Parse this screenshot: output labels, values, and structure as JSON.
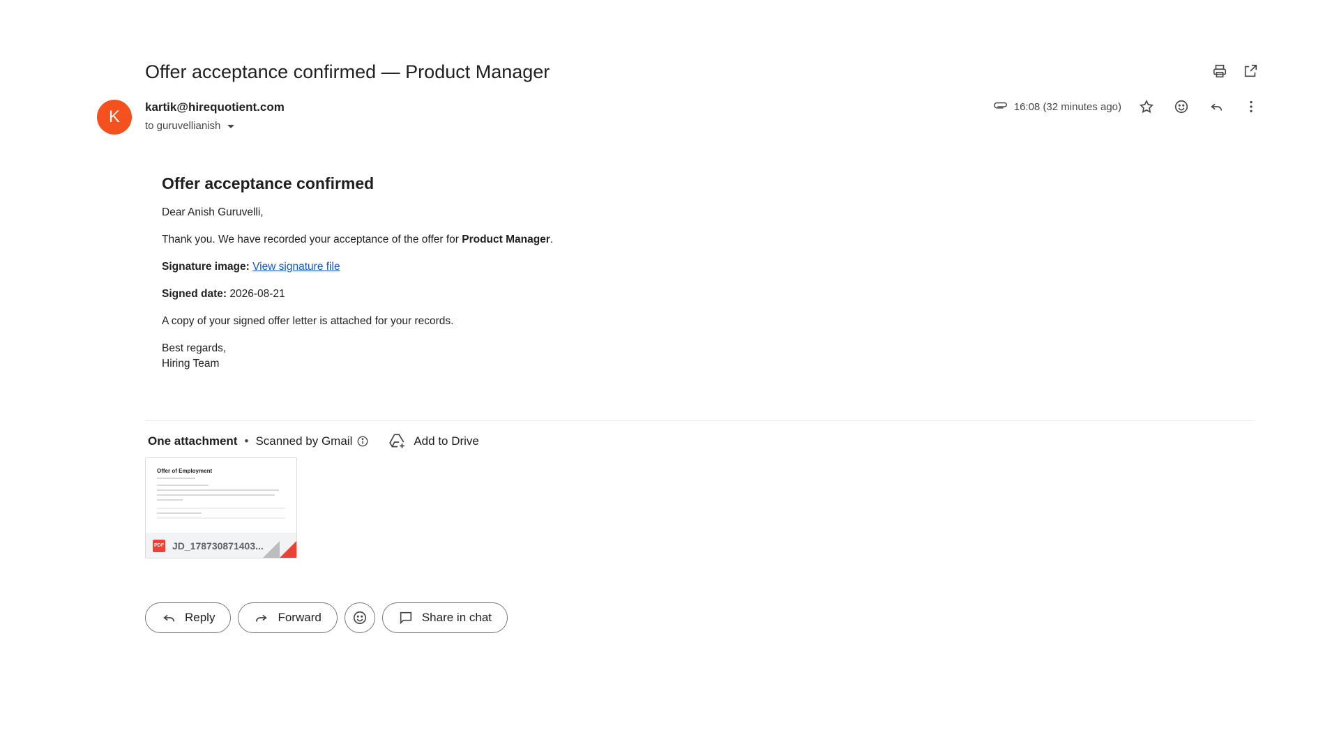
{
  "email": {
    "subject": "Offer acceptance confirmed — Product Manager",
    "avatar_letter": "K",
    "avatar_color": "#f4511e",
    "sender": "kartik@hirequotient.com",
    "recipient": "to guruvellianish",
    "timestamp": "16:08 (32 minutes ago)"
  },
  "top_actions": {
    "print_icon": "print-icon",
    "open_new_window_icon": "open-in-new-icon"
  },
  "meta_actions": {
    "attachment_icon": "paperclip-icon",
    "star_icon": "star-icon",
    "emoji_icon": "emoji-icon",
    "reply_icon": "reply-icon",
    "more_icon": "more-vertical-icon"
  },
  "body": {
    "heading": "Offer acceptance confirmed",
    "greeting": "Dear Anish Guruvelli,",
    "line1_prefix": "Thank you. We have recorded your acceptance of the offer for ",
    "line1_bold": "Product Manager",
    "line1_suffix": ".",
    "signature_label": "Signature image:",
    "signature_link": "View signature file",
    "signed_date_label": "Signed date:",
    "signed_date_value": "2026-08-21",
    "copy_note": "A copy of your signed offer letter is attached for your records.",
    "closing": "Best regards,",
    "team": "Hiring Team",
    "link_color": "#1155cc"
  },
  "attachments": {
    "count_label": "One attachment",
    "separator": "•",
    "scanned_label": "Scanned by Gmail",
    "add_to_drive": "Add to Drive",
    "file": {
      "name": "JD_178730871403...",
      "type_badge": "PDF",
      "preview_title": "Offer of Employment"
    }
  },
  "buttons": {
    "reply": "Reply",
    "forward": "Forward",
    "share_in_chat": "Share in chat"
  }
}
